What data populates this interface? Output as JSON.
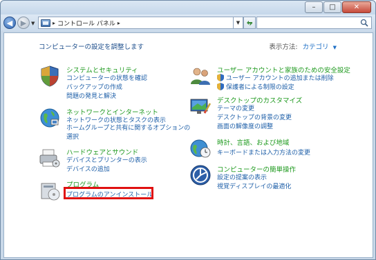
{
  "window": {
    "buttons": {
      "minimize": "–",
      "maximize": "□",
      "close": "✕"
    }
  },
  "address": {
    "breadcrumb": [
      "コントロール パネル"
    ],
    "separator": "▸",
    "search_placeholder": ""
  },
  "header": {
    "title": "コンピューターの設定を調整します",
    "view_by_label": "表示方法:",
    "view_by_value": "カテゴリ"
  },
  "categories": {
    "system": {
      "title": "システムとセキュリティ",
      "links": [
        "コンピューターの状態を確認",
        "バックアップの作成",
        "問題の発見と解決"
      ]
    },
    "network": {
      "title": "ネットワークとインターネット",
      "links": [
        "ネットワークの状態とタスクの表示",
        "ホームグループと共有に関するオプションの選択"
      ]
    },
    "hardware": {
      "title": "ハードウェアとサウンド",
      "links": [
        "デバイスとプリンターの表示",
        "デバイスの追加"
      ]
    },
    "programs": {
      "title": "プログラム",
      "links": [
        "プログラムのアンインストール"
      ]
    },
    "users": {
      "title": "ユーザー アカウントと家族のための安全設定",
      "links": [
        "ユーザー アカウントの追加または削除",
        "保護者による制限の設定"
      ]
    },
    "appearance": {
      "title": "デスクトップのカスタマイズ",
      "links": [
        "テーマの変更",
        "デスクトップの背景の変更",
        "画面の解像度の調整"
      ]
    },
    "clock": {
      "title": "時計、言語、および地域",
      "links": [
        "キーボードまたは入力方法の変更"
      ]
    },
    "ease": {
      "title": "コンピューターの簡単操作",
      "links": [
        "設定の提案の表示",
        "視覚ディスプレイの最適化"
      ]
    }
  },
  "colors": {
    "category_title": "#1f9a1f",
    "link": "#1e5fa8",
    "highlight": "#e01010"
  }
}
